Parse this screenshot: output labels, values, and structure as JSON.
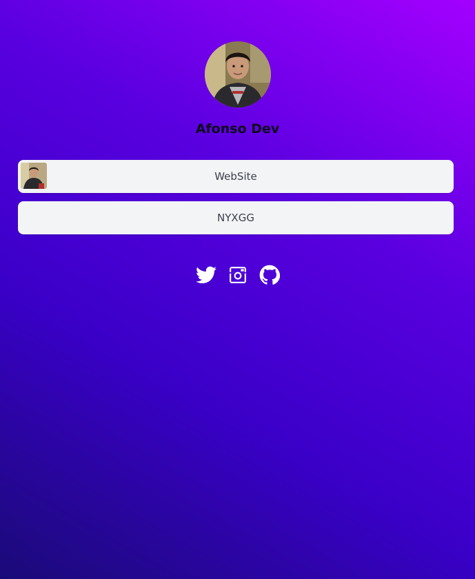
{
  "profile": {
    "name": "Afonso Dev",
    "avatar_icon": "profile-photo"
  },
  "links": [
    {
      "label": "WebSite",
      "has_thumbnail": true
    },
    {
      "label": "NYXGG",
      "has_thumbnail": false
    }
  ],
  "socials": [
    {
      "icon": "twitter-icon"
    },
    {
      "icon": "instagram-icon"
    },
    {
      "icon": "github-icon"
    }
  ],
  "colors": {
    "background_start": "#1a0a78",
    "background_end": "#a300ff",
    "button_bg": "#f3f4f6",
    "button_text": "#3a3f4a",
    "icon": "#ffffff"
  }
}
